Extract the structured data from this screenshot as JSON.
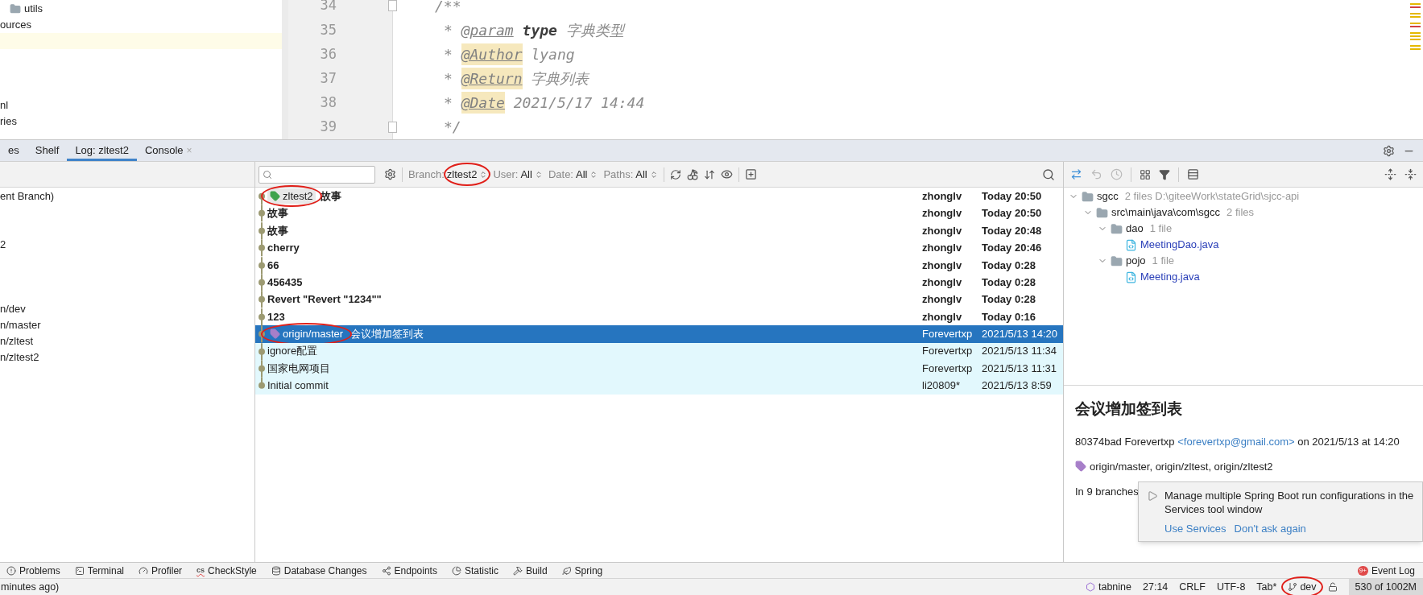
{
  "project_tree": [
    {
      "label": "utils",
      "kind": "folder"
    },
    {
      "label": "ources",
      "kind": "text"
    },
    {
      "kind": "caret_row"
    },
    {
      "kind": "text"
    },
    {
      "kind": "text"
    },
    {
      "kind": "text"
    },
    {
      "label": "nl",
      "kind": "text"
    },
    {
      "label": "ries",
      "kind": "text"
    }
  ],
  "editor": {
    "lines": [
      {
        "number": "34",
        "fold": true,
        "tokens": [
          {
            "text": "/**",
            "kind": "comment"
          }
        ]
      },
      {
        "number": "35",
        "fold": false,
        "tokens": [
          {
            "text": "* ",
            "kind": "comment"
          },
          {
            "text": "@param",
            "kind": "tag"
          },
          {
            "text": " type",
            "kind": "name"
          },
          {
            "text": " 字典类型",
            "kind": "comment"
          }
        ]
      },
      {
        "number": "36",
        "fold": false,
        "tokens": [
          {
            "text": "* ",
            "kind": "comment"
          },
          {
            "text": "@Author",
            "kind": "tag_marked"
          },
          {
            "text": " lyang",
            "kind": "comment"
          }
        ]
      },
      {
        "number": "37",
        "fold": false,
        "tokens": [
          {
            "text": "* ",
            "kind": "comment"
          },
          {
            "text": "@Return",
            "kind": "tag_marked"
          },
          {
            "text": " 字典列表",
            "kind": "comment"
          }
        ]
      },
      {
        "number": "38",
        "fold": false,
        "tokens": [
          {
            "text": "* ",
            "kind": "comment"
          },
          {
            "text": "@Date",
            "kind": "tag_marked"
          },
          {
            "text": " 2021/5/17 14:44",
            "kind": "comment"
          }
        ]
      },
      {
        "number": "39",
        "fold": true,
        "tokens": [
          {
            "text": "*/",
            "kind": "comment"
          }
        ]
      }
    ]
  },
  "tool_tabs": [
    {
      "label": "es",
      "selected": false
    },
    {
      "label": "Shelf",
      "selected": false
    },
    {
      "label": "Log: zltest2",
      "selected": true
    },
    {
      "label": "Console",
      "selected": false,
      "close": "×"
    }
  ],
  "branches": [
    {
      "kind": "label",
      "label": "ent Branch)"
    },
    {
      "kind": "blank"
    },
    {
      "kind": "blank"
    },
    {
      "kind": "label",
      "label": "2"
    },
    {
      "kind": "blank"
    },
    {
      "kind": "blank"
    },
    {
      "kind": "blank"
    },
    {
      "kind": "label",
      "label": "n/dev"
    },
    {
      "kind": "label",
      "label": "n/master"
    },
    {
      "kind": "label",
      "label": "n/zltest"
    },
    {
      "kind": "label",
      "label": "n/zltest2"
    }
  ],
  "filters": [
    {
      "label": "Branch:",
      "value": "zltest2",
      "circled": true
    },
    {
      "label": "User:",
      "value": "All",
      "circled": false
    },
    {
      "label": "Date:",
      "value": "All",
      "circled": false
    },
    {
      "label": "Paths:",
      "value": "All",
      "circled": false
    }
  ],
  "commits": [
    {
      "message": "故事",
      "refs": [
        {
          "name": "zltest2",
          "color": "#3fa34d",
          "circled": true
        }
      ],
      "author": "zhonglv",
      "date": "Today 20:50",
      "bold": true,
      "selected": false,
      "highlighted": false
    },
    {
      "message": "故事",
      "author": "zhonglv",
      "date": "Today 20:50",
      "bold": true,
      "selected": false,
      "highlighted": false
    },
    {
      "message": "故事",
      "author": "zhonglv",
      "date": "Today 20:48",
      "bold": true,
      "selected": false,
      "highlighted": false
    },
    {
      "message": "cherry",
      "author": "zhonglv",
      "date": "Today 20:46",
      "bold": true,
      "selected": false,
      "highlighted": false
    },
    {
      "message": "66",
      "author": "zhonglv",
      "date": "Today 0:28",
      "bold": true,
      "selected": false,
      "highlighted": false
    },
    {
      "message": "456435",
      "author": "zhonglv",
      "date": "Today 0:28",
      "bold": true,
      "selected": false,
      "highlighted": false
    },
    {
      "message": "Revert \"Revert \"1234\"\"",
      "author": "zhonglv",
      "date": "Today 0:28",
      "bold": true,
      "selected": false,
      "highlighted": false
    },
    {
      "message": "123",
      "author": "zhonglv",
      "date": "Today 0:16",
      "bold": true,
      "selected": false,
      "highlighted": false
    },
    {
      "message": "会议增加签到表",
      "refs": [
        {
          "name": "origin/master",
          "color": "#a77fc9",
          "circled": true
        }
      ],
      "author": "Forevertxp",
      "date": "2021/5/13 14:20",
      "bold": false,
      "selected": true,
      "highlighted": true
    },
    {
      "message": "ignore配置",
      "author": "Forevertxp",
      "date": "2021/5/13 11:34",
      "bold": false,
      "selected": false,
      "highlighted": true
    },
    {
      "message": "国家电网项目",
      "author": "Forevertxp",
      "date": "2021/5/13 11:31",
      "bold": false,
      "selected": false,
      "highlighted": true
    },
    {
      "message": "Initial commit",
      "author": "li20809*",
      "date": "2021/5/13 8:59",
      "bold": false,
      "selected": false,
      "highlighted": true
    }
  ],
  "changes": [
    {
      "name": "sgcc",
      "detail": "2 files  D:\\giteeWork\\stateGrid\\sjcc-api",
      "kind": "module",
      "expanded": true,
      "children": [
        {
          "name": "src\\main\\java\\com\\sgcc",
          "detail": "2 files",
          "kind": "folder",
          "expanded": true,
          "children": [
            {
              "name": "dao",
              "detail": "1 file",
              "kind": "folder",
              "expanded": true,
              "children": [
                {
                  "name": "MeetingDao.java",
                  "kind": "file"
                }
              ]
            },
            {
              "name": "pojo",
              "detail": "1 file",
              "kind": "folder",
              "expanded": true,
              "children": [
                {
                  "name": "Meeting.java",
                  "kind": "file"
                }
              ]
            }
          ]
        }
      ]
    }
  ],
  "details": {
    "title": "会议增加签到表",
    "hash": "80374bad",
    "author": "Forevertxp",
    "email": "<forevertxp@gmail.com>",
    "when": "on 2021/5/13 at 14:20",
    "refs": "origin/master, origin/zltest, origin/zltest2",
    "branches": "In 9 branches"
  },
  "notification": {
    "message": "Manage multiple Spring Boot run configurations in the Services tool window",
    "actions": [
      "Use Services",
      "Don't ask again"
    ]
  },
  "tool_buttons": [
    {
      "label": "Problems",
      "kind": "problems"
    },
    {
      "label": "Terminal",
      "kind": "terminal"
    },
    {
      "label": "Profiler",
      "kind": "profiler"
    },
    {
      "label": "CheckStyle",
      "kind": "checkstyle",
      "icon_text": "cs"
    },
    {
      "label": "Database Changes",
      "kind": "database"
    },
    {
      "label": "Endpoints",
      "kind": "endpoints"
    },
    {
      "label": "Statistic",
      "kind": "statistic"
    },
    {
      "label": "Build",
      "kind": "build"
    },
    {
      "label": "Spring",
      "kind": "spring"
    }
  ],
  "event_log": {
    "label": "Event Log",
    "badge": "9+"
  },
  "status_bar": {
    "message": "minutes ago)",
    "tabnine": "tabnine",
    "position": "27:14",
    "line_separator": "CRLF",
    "encoding": "UTF-8",
    "indent": "Tab*",
    "branch": {
      "name": "dev",
      "circled": true
    },
    "memory": "530 of 1002M"
  }
}
